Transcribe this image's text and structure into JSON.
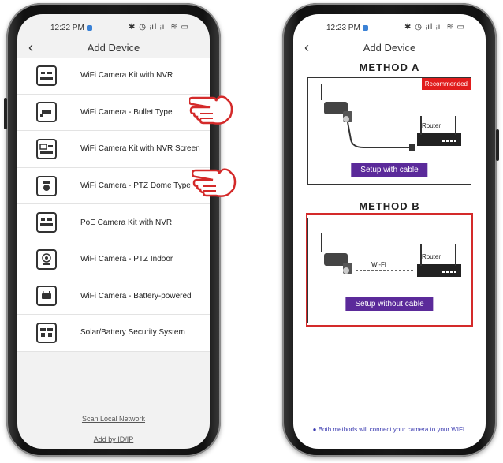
{
  "left_phone": {
    "status": {
      "time": "12:22 PM",
      "icons": "✱ ◷ ᵢıl ᵢıl ≋ ▭"
    },
    "header": {
      "back_icon": "chevron-left-icon",
      "title": "Add Device"
    },
    "devices": [
      {
        "label": "WiFi Camera Kit with NVR",
        "icon": "camera-kit-nvr-icon"
      },
      {
        "label": "WiFi Camera - Bullet Type",
        "icon": "bullet-camera-icon"
      },
      {
        "label": "WiFi Camera Kit with NVR Screen",
        "icon": "camera-kit-screen-icon"
      },
      {
        "label": "WiFi Camera - PTZ Dome Type",
        "icon": "ptz-dome-camera-icon"
      },
      {
        "label": "PoE Camera Kit with NVR",
        "icon": "poe-kit-icon"
      },
      {
        "label": "WiFi Camera - PTZ Indoor",
        "icon": "ptz-indoor-camera-icon"
      },
      {
        "label": "WiFi Camera - Battery-powered",
        "icon": "battery-camera-icon"
      },
      {
        "label": "Solar/Battery Security System",
        "icon": "solar-system-icon"
      }
    ],
    "links": {
      "scan": "Scan Local Network",
      "add_by_id": "Add by ID/IP"
    }
  },
  "right_phone": {
    "status": {
      "time": "12:23 PM",
      "icons": "✱ ◷ ᵢıl ᵢıl ≋ ▭"
    },
    "header": {
      "back_icon": "chevron-left-icon",
      "title": "Add Device"
    },
    "method_a": {
      "title": "METHOD A",
      "badge": "Recommended",
      "router_label": "Router",
      "button": "Setup with cable"
    },
    "method_b": {
      "title": "METHOD B",
      "wifi_label": "Wi-Fi",
      "router_label": "Router",
      "button": "Setup without cable"
    },
    "footnote": "● Both methods will connect your camera to your WIFI."
  },
  "colors": {
    "accent_purple": "#5b2a9a",
    "highlight_red": "#d42a2a",
    "badge_red": "#e11d1d"
  }
}
